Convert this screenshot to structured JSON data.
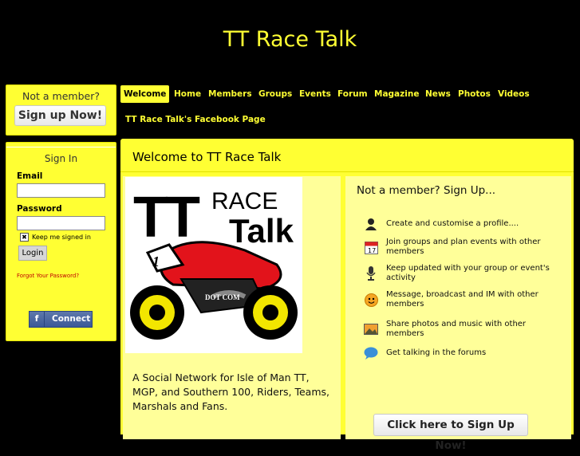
{
  "site": {
    "title": "TT Race Talk"
  },
  "sidebar": {
    "member_heading": "Not a member?",
    "signup_button": "Sign up Now!",
    "signin_heading": "Sign In",
    "email_label": "Email",
    "password_label": "Password",
    "keep_signed_in": "Keep me signed in",
    "keep_checked": true,
    "login_button": "Login",
    "forgot_link": "Forgot Your Password?",
    "facebook_connect": "Connect"
  },
  "nav": {
    "items": [
      "Welcome",
      "Home",
      "Members",
      "Groups",
      "Events",
      "Forum",
      "Magazine",
      "News",
      "Photos",
      "Videos"
    ],
    "active": "Welcome",
    "second_row": "TT Race Talk's Facebook Page"
  },
  "main": {
    "title": "Welcome to TT Race Talk",
    "logo": {
      "line1": "TT",
      "line2": "RACE",
      "line3": "Talk",
      "plate": "1",
      "tag": "DOT COM"
    },
    "intro": "A Social Network for Isle of Man TT, MGP, and Southern 100, Riders, Teams, Marshals and Fans.",
    "signup_heading": "Not a member? Sign Up...",
    "features": [
      {
        "icon": "profile-icon",
        "text": "Create and customise a profile...."
      },
      {
        "icon": "calendar-icon",
        "text": "Join groups and plan events with other members"
      },
      {
        "icon": "microphone-icon",
        "text": "Keep updated with your group or event's activity"
      },
      {
        "icon": "smiley-icon",
        "text": "Message, broadcast and IM with other members"
      },
      {
        "icon": "photo-icon",
        "text": "Share photos and music with other members"
      },
      {
        "icon": "speech-bubble-icon",
        "text": "Get talking in the forums"
      }
    ],
    "signup_button": "Click here to Sign Up Now!"
  },
  "colors": {
    "accent": "#ffff33",
    "panel": "#ffff99",
    "background": "#000000",
    "link": "#c00000",
    "facebook": "#3b5998"
  }
}
